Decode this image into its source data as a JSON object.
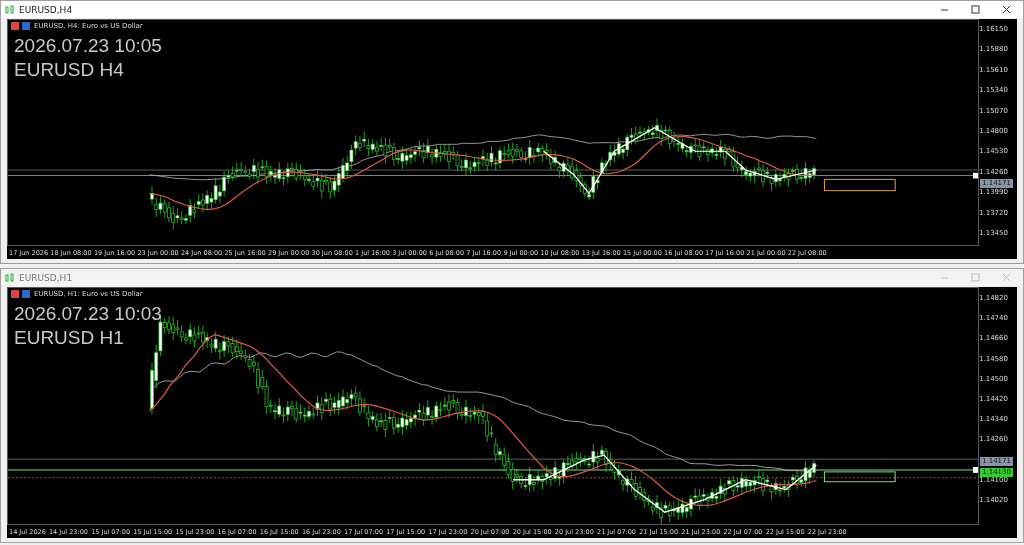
{
  "windows": [
    {
      "title": "EURUSD,H4",
      "active": true,
      "chart": {
        "header": "EURUSD, H4:  Euro vs US Dollar",
        "overlay_lines": [
          "2026.07.23 10:05",
          "EURUSD H4"
        ],
        "price_ticks": [
          "1.16150",
          "1.15880",
          "1.15610",
          "1.15340",
          "1.15070",
          "1.14800",
          "1.14530",
          "1.14260",
          "1.13990",
          "1.13720",
          "1.13450"
        ],
        "price_labels": [
          {
            "text": "1.14171",
            "color": "#8796a8"
          }
        ],
        "time_labels": [
          "17 Jun 2026",
          "18 Jun 08:00",
          "19 Jun 16:00",
          "23 Jun 00:00",
          "24 Jun 08:00",
          "25 Jun 16:00",
          "29 Jun 00:00",
          "30 Jun 08:00",
          "1 Jul 16:00",
          "3 Jul 00:00",
          "6 Jul 08:00",
          "7 Jul 16:00",
          "9 Jul 00:00",
          "10 Jul 08:00",
          "13 Jul 16:00",
          "15 Jul 00:00",
          "16 Jul 08:00",
          "17 Jul 16:00",
          "21 Jul 00:00",
          "22 Jul 08:00"
        ]
      }
    },
    {
      "title": "EURUSD,H1",
      "active": false,
      "chart": {
        "header": "EURUSD, H1:  Euro vs US Dollar",
        "overlay_lines": [
          "2026.07.23 10:03",
          "EURUSD H1"
        ],
        "price_ticks": [
          "1.14820",
          "1.14740",
          "1.14660",
          "1.14580",
          "1.14500",
          "1.14420",
          "1.14340",
          "1.14260",
          "1.14100",
          "1.14020"
        ],
        "price_labels": [
          {
            "text": "1.14171",
            "color": "#8796a8"
          },
          {
            "text": "1.14130",
            "color": "#33cc33"
          }
        ],
        "time_labels": [
          "14 Jul 2026",
          "14 Jul 23:00",
          "15 Jul 07:00",
          "15 Jul 15:00",
          "15 Jul 23:00",
          "16 Jul 07:00",
          "16 Jul 15:00",
          "16 Jul 23:00",
          "17 Jul 07:00",
          "17 Jul 15:00",
          "17 Jul 23:00",
          "20 Jul 07:00",
          "20 Jul 15:00",
          "20 Jul 23:00",
          "21 Jul 07:00",
          "21 Jul 15:00",
          "21 Jul 23:00",
          "22 Jul 07:00",
          "22 Jul 15:00",
          "22 Jul 23:00"
        ]
      }
    }
  ]
}
